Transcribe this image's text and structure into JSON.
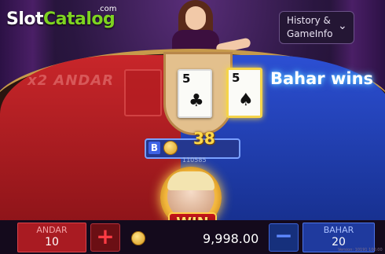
{
  "logo": {
    "name_part1": "Slot",
    "name_part2": "Catalog",
    "suffix": ".com"
  },
  "history_button": {
    "line1": "History  &",
    "line2": "GameInfo",
    "icon": "chevron-down-icon"
  },
  "table": {
    "andar_label": "x2  ANDAR",
    "joker_card": {
      "rank": "5",
      "suit": "♣"
    },
    "bahar_card": {
      "rank": "5",
      "suit": "♠"
    },
    "result_text": "Bahar wins",
    "bet_pill_letter": "B",
    "win_amount": "38",
    "small_count": "110585"
  },
  "win_badge": "WIN",
  "bottom": {
    "andar_label": "ANDAR",
    "andar_value": "10",
    "plus_symbol": "+",
    "balance": "9,998.00",
    "minus_symbol": "−",
    "bahar_label": "BAHAR",
    "bahar_value": "20",
    "footer_id": "Version: 10191 100.00"
  },
  "colors": {
    "andar_red": "#c8262a",
    "bahar_blue": "#2c4fd3",
    "gold": "#ffd94a",
    "logo_green": "#7ed321"
  }
}
